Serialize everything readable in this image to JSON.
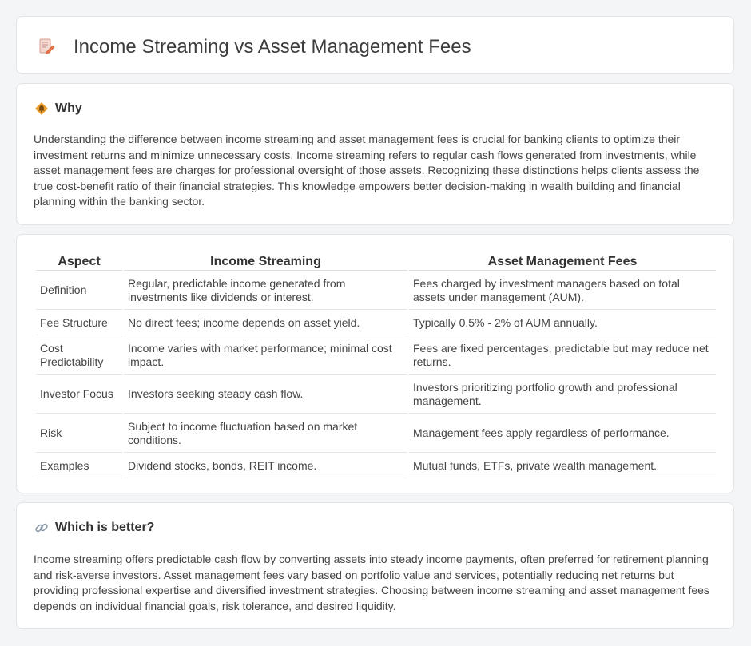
{
  "header": {
    "title": "Income Streaming vs Asset Management Fees",
    "icon": "document-pencil-icon"
  },
  "why": {
    "title": "Why",
    "icon": "bell-diamond-icon",
    "text": "Understanding the difference between income streaming and asset management fees is crucial for banking clients to optimize their investment returns and minimize unnecessary costs. Income streaming refers to regular cash flows generated from investments, while asset management fees are charges for professional oversight of those assets. Recognizing these distinctions helps clients assess the true cost-benefit ratio of their financial strategies. This knowledge empowers better decision-making in wealth building and financial planning within the banking sector."
  },
  "table": {
    "headers": [
      "Aspect",
      "Income Streaming",
      "Asset Management Fees"
    ],
    "rows": [
      [
        "Definition",
        "Regular, predictable income generated from investments like dividends or interest.",
        "Fees charged by investment managers based on total assets under management (AUM)."
      ],
      [
        "Fee Structure",
        "No direct fees; income depends on asset yield.",
        "Typically 0.5% - 2% of AUM annually."
      ],
      [
        "Cost Predictability",
        "Income varies with market performance; minimal cost impact.",
        "Fees are fixed percentages, predictable but may reduce net returns."
      ],
      [
        "Investor Focus",
        "Investors seeking steady cash flow.",
        "Investors prioritizing portfolio growth and professional management."
      ],
      [
        "Risk",
        "Subject to income fluctuation based on market conditions.",
        "Management fees apply regardless of performance."
      ],
      [
        "Examples",
        "Dividend stocks, bonds, REIT income.",
        "Mutual funds, ETFs, private wealth management."
      ]
    ]
  },
  "better": {
    "title": "Which is better?",
    "icon": "link-icon",
    "text": "Income streaming offers predictable cash flow by converting assets into steady income payments, often preferred for retirement planning and risk-averse investors. Asset management fees vary based on portfolio value and services, potentially reducing net returns but providing professional expertise and diversified investment strategies. Choosing between income streaming and asset management fees depends on individual financial goals, risk tolerance, and desired liquidity."
  },
  "colors": {
    "background": "#f4f5f7",
    "card": "#ffffff",
    "accent_orange": "#f0a030",
    "icon_pink": "#e07070"
  }
}
